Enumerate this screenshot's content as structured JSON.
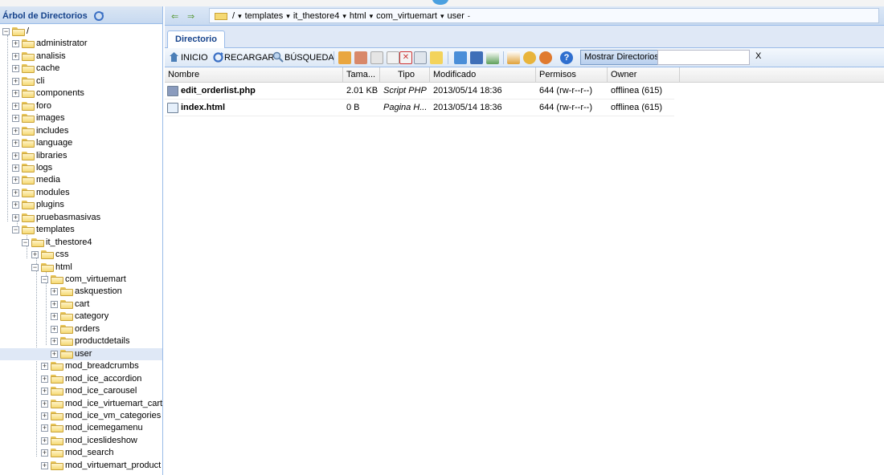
{
  "left_panel": {
    "title": "Árbol de Directorios",
    "root_label": "/",
    "nodes": [
      {
        "label": "administrator",
        "level": 1,
        "state": "closed"
      },
      {
        "label": "analisis",
        "level": 1,
        "state": "closed"
      },
      {
        "label": "cache",
        "level": 1,
        "state": "closed"
      },
      {
        "label": "cli",
        "level": 1,
        "state": "closed"
      },
      {
        "label": "components",
        "level": 1,
        "state": "closed"
      },
      {
        "label": "foro",
        "level": 1,
        "state": "closed"
      },
      {
        "label": "images",
        "level": 1,
        "state": "closed"
      },
      {
        "label": "includes",
        "level": 1,
        "state": "closed"
      },
      {
        "label": "language",
        "level": 1,
        "state": "closed"
      },
      {
        "label": "libraries",
        "level": 1,
        "state": "closed"
      },
      {
        "label": "logs",
        "level": 1,
        "state": "closed"
      },
      {
        "label": "media",
        "level": 1,
        "state": "closed"
      },
      {
        "label": "modules",
        "level": 1,
        "state": "closed"
      },
      {
        "label": "plugins",
        "level": 1,
        "state": "closed"
      },
      {
        "label": "pruebasmasivas",
        "level": 1,
        "state": "closed"
      },
      {
        "label": "templates",
        "level": 1,
        "state": "open"
      },
      {
        "label": "it_thestore4",
        "level": 2,
        "state": "open"
      },
      {
        "label": "css",
        "level": 3,
        "state": "closed"
      },
      {
        "label": "html",
        "level": 3,
        "state": "open"
      },
      {
        "label": "com_virtuemart",
        "level": 4,
        "state": "open"
      },
      {
        "label": "askquestion",
        "level": 5,
        "state": "closed"
      },
      {
        "label": "cart",
        "level": 5,
        "state": "closed"
      },
      {
        "label": "category",
        "level": 5,
        "state": "closed"
      },
      {
        "label": "orders",
        "level": 5,
        "state": "closed"
      },
      {
        "label": "productdetails",
        "level": 5,
        "state": "closed"
      },
      {
        "label": "user",
        "level": 5,
        "state": "closed",
        "selected": true
      },
      {
        "label": "mod_breadcrumbs",
        "level": 4,
        "state": "closed"
      },
      {
        "label": "mod_ice_accordion",
        "level": 4,
        "state": "closed"
      },
      {
        "label": "mod_ice_carousel",
        "level": 4,
        "state": "closed"
      },
      {
        "label": "mod_ice_virtuemart_cart",
        "level": 4,
        "state": "closed"
      },
      {
        "label": "mod_ice_vm_categories",
        "level": 4,
        "state": "closed"
      },
      {
        "label": "mod_icemegamenu",
        "level": 4,
        "state": "closed"
      },
      {
        "label": "mod_iceslideshow",
        "level": 4,
        "state": "closed"
      },
      {
        "label": "mod_search",
        "level": 4,
        "state": "closed"
      },
      {
        "label": "mod_virtuemart_product",
        "level": 4,
        "state": "closed"
      }
    ]
  },
  "breadcrumb": {
    "items": [
      "/",
      "templates",
      "it_thestore4",
      "html",
      "com_virtuemart",
      "user"
    ]
  },
  "tabs": [
    {
      "label": "Directorio"
    }
  ],
  "toolbar": {
    "inicio": "INICIO",
    "recargar": "RECARGAR",
    "busqueda": "BÚSQUEDA",
    "mostrar": "Mostrar Directorios",
    "search_value": "",
    "clear": "X"
  },
  "grid": {
    "columns": [
      "Nombre",
      "Tama...",
      "Tipo",
      "Modificado",
      "Permisos",
      "Owner"
    ],
    "rows": [
      {
        "name": "edit_orderlist.php",
        "size": "2.01 KB",
        "type": "Script PHP",
        "modified": "2013/05/14 18:36",
        "perms": "644 (rw-r--r--)",
        "owner": "offlinea (615)",
        "icon": "php-file-icon"
      },
      {
        "name": "index.html",
        "size": "0 B",
        "type": "Pagina H...",
        "modified": "2013/05/14 18:36",
        "perms": "644 (rw-r--r--)",
        "owner": "offlinea (615)",
        "icon": "html-file-icon"
      }
    ]
  },
  "colors": {
    "accent": "#15428b",
    "selection": "#dfe8f6",
    "border": "#99bbe8"
  }
}
